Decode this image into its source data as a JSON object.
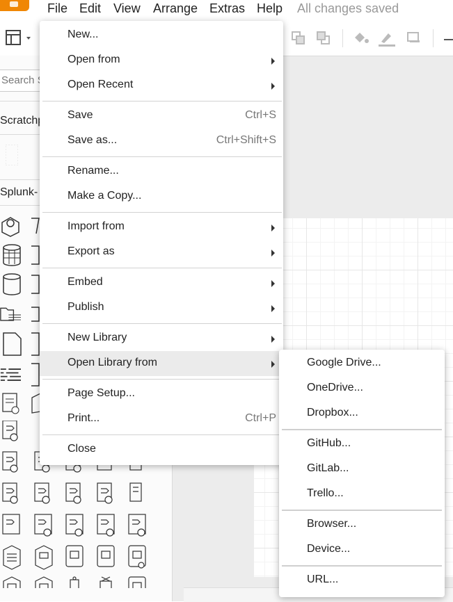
{
  "menubar": {
    "items": [
      "File",
      "Edit",
      "View",
      "Arrange",
      "Extras",
      "Help"
    ],
    "status": "All changes saved"
  },
  "sidebar": {
    "search_placeholder": "Search Shapes",
    "scratchpad_label": "Scratchpad",
    "splunk_label": "Splunk-"
  },
  "file_menu": {
    "new": "New...",
    "open_from": "Open from",
    "open_recent": "Open Recent",
    "save": "Save",
    "save_shortcut": "Ctrl+S",
    "save_as": "Save as...",
    "save_as_shortcut": "Ctrl+Shift+S",
    "rename": "Rename...",
    "make_copy": "Make a Copy...",
    "import_from": "Import from",
    "export_as": "Export as",
    "embed": "Embed",
    "publish": "Publish",
    "new_library": "New Library",
    "open_library_from": "Open Library from",
    "page_setup": "Page Setup...",
    "print": "Print...",
    "print_shortcut": "Ctrl+P",
    "close": "Close"
  },
  "library_submenu": {
    "google_drive": "Google Drive...",
    "onedrive": "OneDrive...",
    "dropbox": "Dropbox...",
    "github": "GitHub...",
    "gitlab": "GitLab...",
    "trello": "Trello...",
    "browser": "Browser...",
    "device": "Device...",
    "url": "URL..."
  }
}
